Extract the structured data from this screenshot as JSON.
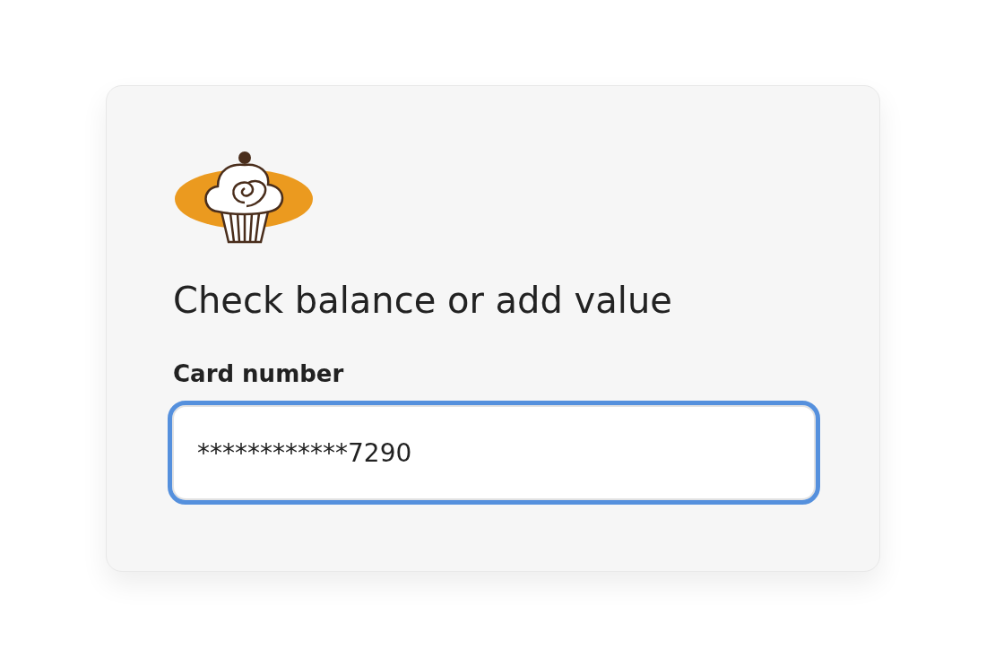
{
  "card": {
    "title": "Check balance or add value",
    "field": {
      "label": "Card number",
      "value": "************7290",
      "focused": true
    }
  }
}
